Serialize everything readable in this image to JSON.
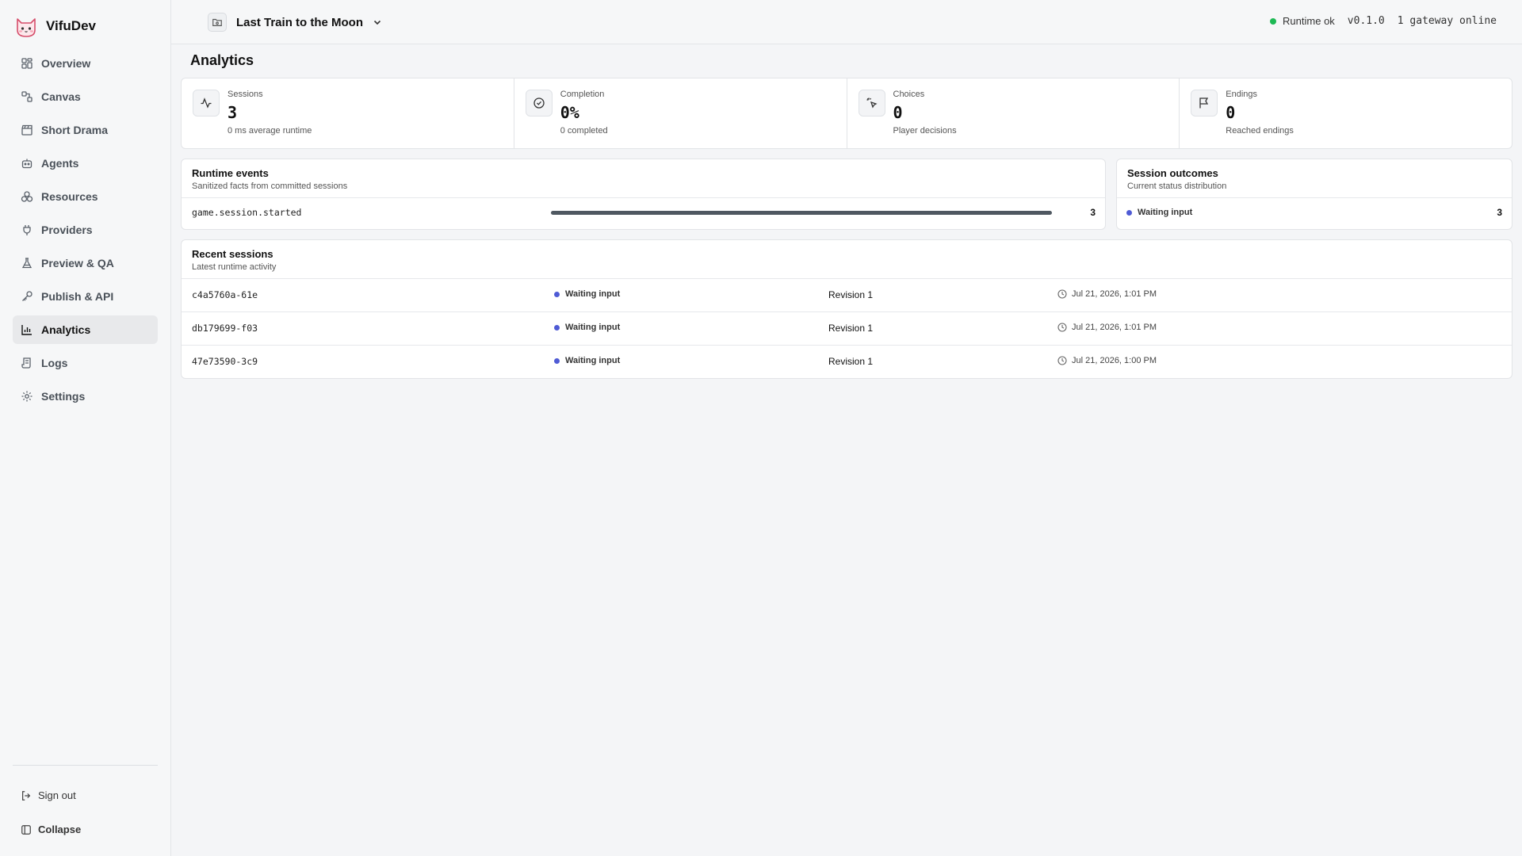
{
  "brand": {
    "name": "VifuDev"
  },
  "sidebar": {
    "items": [
      {
        "label": "Overview",
        "icon": "layout-grid-icon"
      },
      {
        "label": "Canvas",
        "icon": "workflow-icon"
      },
      {
        "label": "Short Drama",
        "icon": "clapperboard-icon"
      },
      {
        "label": "Agents",
        "icon": "bot-icon"
      },
      {
        "label": "Resources",
        "icon": "boxes-icon"
      },
      {
        "label": "Providers",
        "icon": "plug-icon"
      },
      {
        "label": "Preview & QA",
        "icon": "flask-icon"
      },
      {
        "label": "Publish & API",
        "icon": "key-icon"
      },
      {
        "label": "Analytics",
        "icon": "bar-chart-icon",
        "active": true
      },
      {
        "label": "Logs",
        "icon": "scroll-icon"
      },
      {
        "label": "Settings",
        "icon": "gear-icon"
      }
    ],
    "sign_out": "Sign out",
    "collapse": "Collapse"
  },
  "topbar": {
    "project": "Last Train to the Moon",
    "runtime_status": "Runtime ok",
    "version": "v0.1.0",
    "gateways": "1 gateway online",
    "status_color": "#1db954"
  },
  "page": {
    "title": "Analytics"
  },
  "stats": [
    {
      "label": "Sessions",
      "value": "3",
      "sub": "0 ms average runtime",
      "icon": "activity-icon"
    },
    {
      "label": "Completion",
      "value": "0%",
      "sub": "0 completed",
      "icon": "check-circle-icon"
    },
    {
      "label": "Choices",
      "value": "0",
      "sub": "Player decisions",
      "icon": "pointer-click-icon"
    },
    {
      "label": "Endings",
      "value": "0",
      "sub": "Reached endings",
      "icon": "flag-icon"
    }
  ],
  "runtime_events": {
    "title": "Runtime events",
    "subtitle": "Sanitized facts from committed sessions",
    "events": [
      {
        "name": "game.session.started",
        "count": "3",
        "fraction": 1.0
      }
    ]
  },
  "session_outcomes": {
    "title": "Session outcomes",
    "subtitle": "Current status distribution",
    "outcomes": [
      {
        "label": "Waiting input",
        "count": "3",
        "color": "#4f5bd5"
      }
    ]
  },
  "recent_sessions": {
    "title": "Recent sessions",
    "subtitle": "Latest runtime activity",
    "rows": [
      {
        "id": "c4a5760a-61e",
        "status": "Waiting input",
        "revision": "Revision 1",
        "time": "Jul 21, 2026, 1:01 PM"
      },
      {
        "id": "db179699-f03",
        "status": "Waiting input",
        "revision": "Revision 1",
        "time": "Jul 21, 2026, 1:01 PM"
      },
      {
        "id": "47e73590-3c9",
        "status": "Waiting input",
        "revision": "Revision 1",
        "time": "Jul 21, 2026, 1:00 PM"
      }
    ]
  }
}
